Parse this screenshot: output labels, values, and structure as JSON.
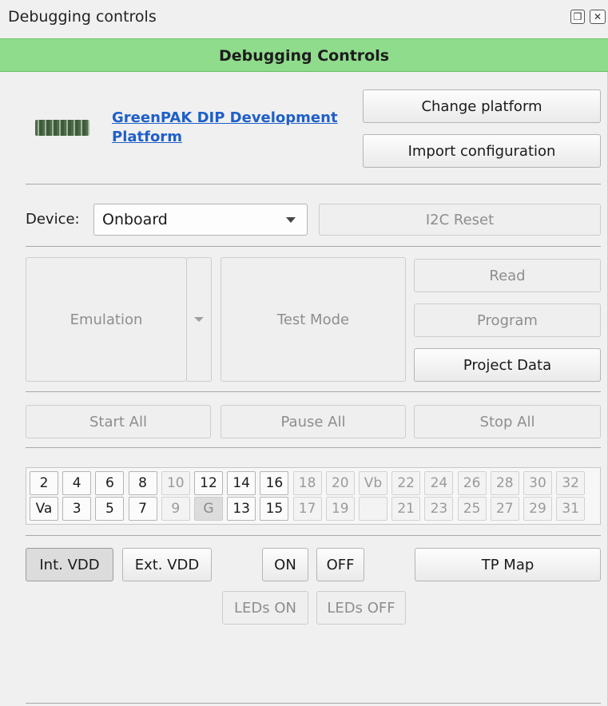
{
  "window": {
    "title": "Debugging controls",
    "restore_icon": "restore-icon",
    "close_icon": "close-icon"
  },
  "header": {
    "title": "Debugging Controls",
    "color": "#8fdc8c"
  },
  "platform": {
    "image": "board-icon",
    "link": "GreenPAK DIP Development Platform",
    "change_label": "Change platform",
    "import_label": "Import configuration"
  },
  "device": {
    "label": "Device:",
    "selected": "Onboard",
    "i2c_reset_label": "I2C Reset"
  },
  "modes": {
    "emulation_label": "Emulation",
    "test_mode_label": "Test Mode",
    "read_label": "Read",
    "program_label": "Program",
    "project_data_label": "Project Data"
  },
  "run": {
    "start_label": "Start All",
    "pause_label": "Pause All",
    "stop_label": "Stop All"
  },
  "pins": {
    "row1": [
      "2",
      "4",
      "6",
      "8",
      "10",
      "12",
      "14",
      "16",
      "18",
      "20",
      "Vb",
      "22",
      "24",
      "26",
      "28",
      "30",
      "32"
    ],
    "row2": [
      "Va",
      "3",
      "5",
      "7",
      "9",
      "G",
      "13",
      "15",
      "17",
      "19",
      "",
      "21",
      "23",
      "25",
      "27",
      "29",
      "31"
    ]
  },
  "power": {
    "int_vdd_label": "Int. VDD",
    "ext_vdd_label": "Ext. VDD",
    "on_label": "ON",
    "off_label": "OFF",
    "tp_map_label": "TP Map",
    "leds_on_label": "LEDs ON",
    "leds_off_label": "LEDs OFF"
  }
}
